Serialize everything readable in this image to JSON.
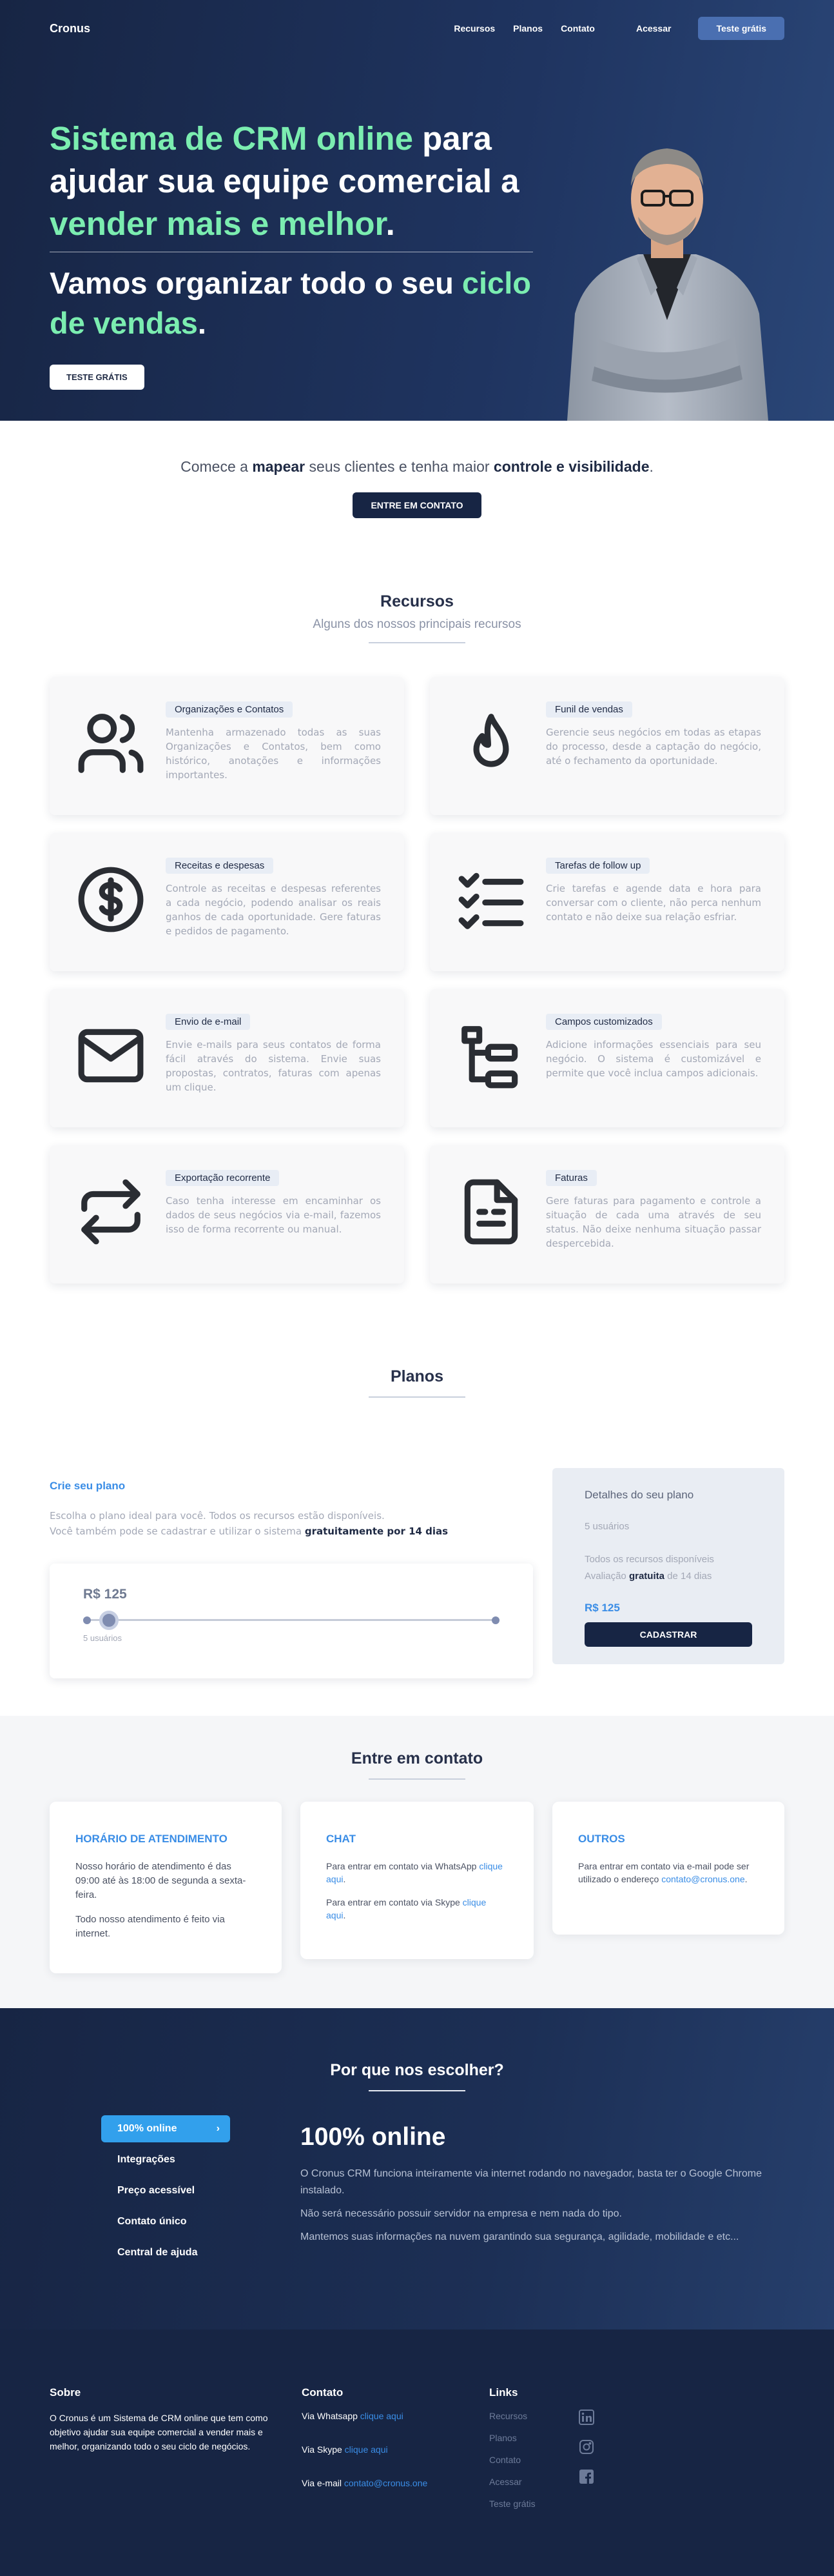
{
  "nav": {
    "brand": "Cronus",
    "links": [
      "Recursos",
      "Planos",
      "Contato"
    ],
    "login": "Acessar",
    "cta": "Teste grátis"
  },
  "hero": {
    "title_green_1": "Sistema de CRM online",
    "title_white_1": " para ajudar sua equipe comercial a ",
    "title_green_2": "vender mais e melhor",
    "title_white_2": ".",
    "sub_white": "Vamos organizar todo o seu ",
    "sub_green": "ciclo de vendas",
    "sub_end": ".",
    "button": "TESTE GRÁTIS"
  },
  "intro": {
    "t1": "Comece a ",
    "b1": "mapear",
    "t2": " seus clientes e tenha maior ",
    "b2": "controle e visibilidade",
    "t3": ".",
    "button": "ENTRE EM CONTATO"
  },
  "recursos": {
    "title": "Recursos",
    "subtitle": "Alguns dos nossos principais recursos",
    "items": [
      {
        "icon": "users-icon",
        "tag": "Organizações e Contatos",
        "text": "Mantenha armazenado todas as suas Organizações e Contatos, bem como histórico, anotações e informações importantes."
      },
      {
        "icon": "flame-icon",
        "tag": "Funil de vendas",
        "text": "Gerencie seus negócios em todas as etapas do processo, desde a captação do negócio, até o fechamento da oportunidade."
      },
      {
        "icon": "dollar-icon",
        "tag": "Receitas e despesas",
        "text": "Controle as receitas e despesas referentes a cada negócio, podendo analisar os reais ganhos de cada oportunidade. Gere faturas e pedidos de pagamento."
      },
      {
        "icon": "checklist-icon",
        "tag": "Tarefas de follow up",
        "text": "Crie tarefas e agende data e hora para conversar com o cliente, não perca nenhum contato e não deixe sua relação esfriar."
      },
      {
        "icon": "mail-icon",
        "tag": "Envio de e-mail",
        "text": "Envie e-mails para seus contatos de forma fácil através do sistema. Envie suas propostas, contratos, faturas com apenas um clique."
      },
      {
        "icon": "tree-icon",
        "tag": "Campos customizados",
        "text": "Adicione informações essenciais para seu negócio. O sistema é customizável e permite que você inclua campos adicionais."
      },
      {
        "icon": "repeat-icon",
        "tag": "Exportação recorrente",
        "text": "Caso tenha interesse em encaminhar os dados de seus negócios via e-mail, fazemos isso de forma recorrente ou manual."
      },
      {
        "icon": "invoice-icon",
        "tag": "Faturas",
        "text": "Gere faturas para pagamento e controle a situação de cada uma através de seu status. Não deixe nenhuma situação passar despercebida."
      }
    ]
  },
  "planos": {
    "title": "Planos",
    "label": "Crie seu plano",
    "desc1": "Escolha o plano ideal para você. Todos os recursos estão disponíveis.",
    "desc2": "Você também pode se cadastrar e utilizar o sistema ",
    "desc2_bold": "gratuitamente por 14 dias",
    "price": "R$ 125",
    "slider_label": "5 usuários",
    "slider_position": 0.05,
    "detail_title": "Detalhes do seu plano",
    "detail_users": "5 usuários",
    "detail_resources": "Todos os recursos disponíveis",
    "detail_trial_1": "Avaliação ",
    "detail_trial_bold": "gratuita",
    "detail_trial_2": " de 14 dias",
    "detail_price": "R$ 125",
    "button": "CADASTRAR"
  },
  "contato": {
    "title": "Entre em contato",
    "cards": [
      {
        "title": "HORÁRIO DE ATENDIMENTO",
        "p1": "Nosso horário de atendimento é das 09:00 até às 18:00 de segunda a sexta-feira.",
        "p2": "Todo nosso atendimento é feito via internet."
      },
      {
        "title": "CHAT",
        "p1": "Para entrar em contato via WhatsApp ",
        "l1": "clique aqui",
        "p1b": ".",
        "p2": "Para entrar em contato via Skype ",
        "l2": "clique aqui",
        "p2b": "."
      },
      {
        "title": "OUTROS",
        "p1": "Para entrar em contato via e-mail pode ser utilizado o endereço ",
        "l1": "contato@cronus.one",
        "p1b": "."
      }
    ]
  },
  "why": {
    "title": "Por que nos escolher?",
    "nav": [
      "100% online",
      "Integrações",
      "Preço acessível",
      "Contato único",
      "Central de ajuda"
    ],
    "heading": "100% online",
    "p1": "O Cronus CRM funciona inteiramente via internet rodando no navegador, basta ter o Google Chrome instalado.",
    "p2": "Não será necessário possuir servidor na empresa e nem nada do tipo.",
    "p3": "Mantemos suas informações na nuvem garantindo sua segurança, agilidade, mobilidade e etc..."
  },
  "footer": {
    "sobre_title": "Sobre",
    "sobre_text": "O Cronus é um Sistema de CRM online que tem como objetivo ajudar sua equipe comercial a vender mais e melhor, organizando todo o seu ciclo de negócios.",
    "contato_title": "Contato",
    "whatsapp": "Via Whatsapp ",
    "whatsapp_link": "clique aqui",
    "skype": "Via Skype ",
    "skype_link": "clique aqui",
    "email": "Via e-mail ",
    "email_link": "contato@cronus.one",
    "links_title": "Links",
    "links": [
      "Recursos",
      "Planos",
      "Contato",
      "Acessar",
      "Teste grátis"
    ],
    "social": [
      "linkedin-icon",
      "instagram-icon",
      "facebook-icon"
    ]
  },
  "colors": {
    "navy": "#172544",
    "green": "#7bedb0",
    "blue": "#3a8de6",
    "highlight": "#32a0ec"
  }
}
